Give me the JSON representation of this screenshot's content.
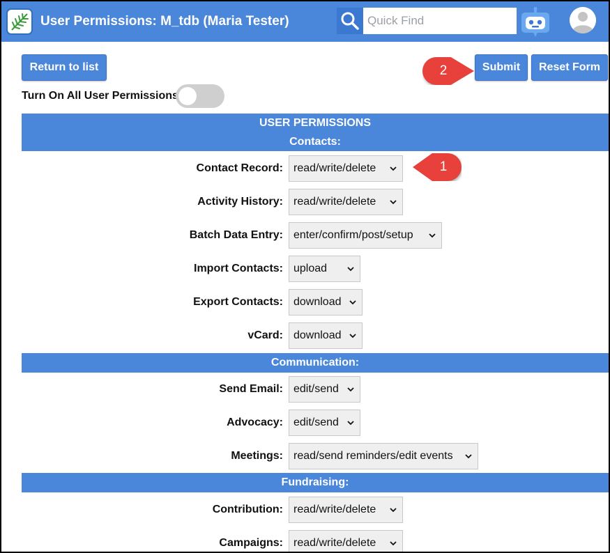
{
  "header": {
    "title": "User Permissions: M_tdb (Maria Tester)",
    "search_placeholder": "Quick Find"
  },
  "toolbar": {
    "return_label": "Return to list",
    "submit_label": "Submit",
    "reset_label": "Reset Form",
    "toggle_label": "Turn On All User Permissions",
    "toggle_on": false
  },
  "callouts": [
    "1",
    "2"
  ],
  "sections": {
    "title": "USER PERMISSIONS",
    "contacts": "Contacts:",
    "communication": "Communication:",
    "fundraising": "Fundraising:"
  },
  "rows": [
    {
      "label": "Contact Record:",
      "value": "read/write/delete"
    },
    {
      "label": "Activity History:",
      "value": "read/write/delete"
    },
    {
      "label": "Batch Data Entry:",
      "value": "enter/confirm/post/setup"
    },
    {
      "label": "Import Contacts:",
      "value": "upload"
    },
    {
      "label": "Export Contacts:",
      "value": "download"
    },
    {
      "label": "vCard:",
      "value": "download"
    },
    {
      "label": "Send Email:",
      "value": "edit/send"
    },
    {
      "label": "Advocacy:",
      "value": "edit/send"
    },
    {
      "label": "Meetings:",
      "value": "read/send reminders/edit events"
    },
    {
      "label": "Contribution:",
      "value": "read/write/delete"
    },
    {
      "label": "Campaigns:",
      "value": "read/write/delete"
    }
  ],
  "colors": {
    "brand": "#4a86da",
    "callout": "#e8403a"
  }
}
